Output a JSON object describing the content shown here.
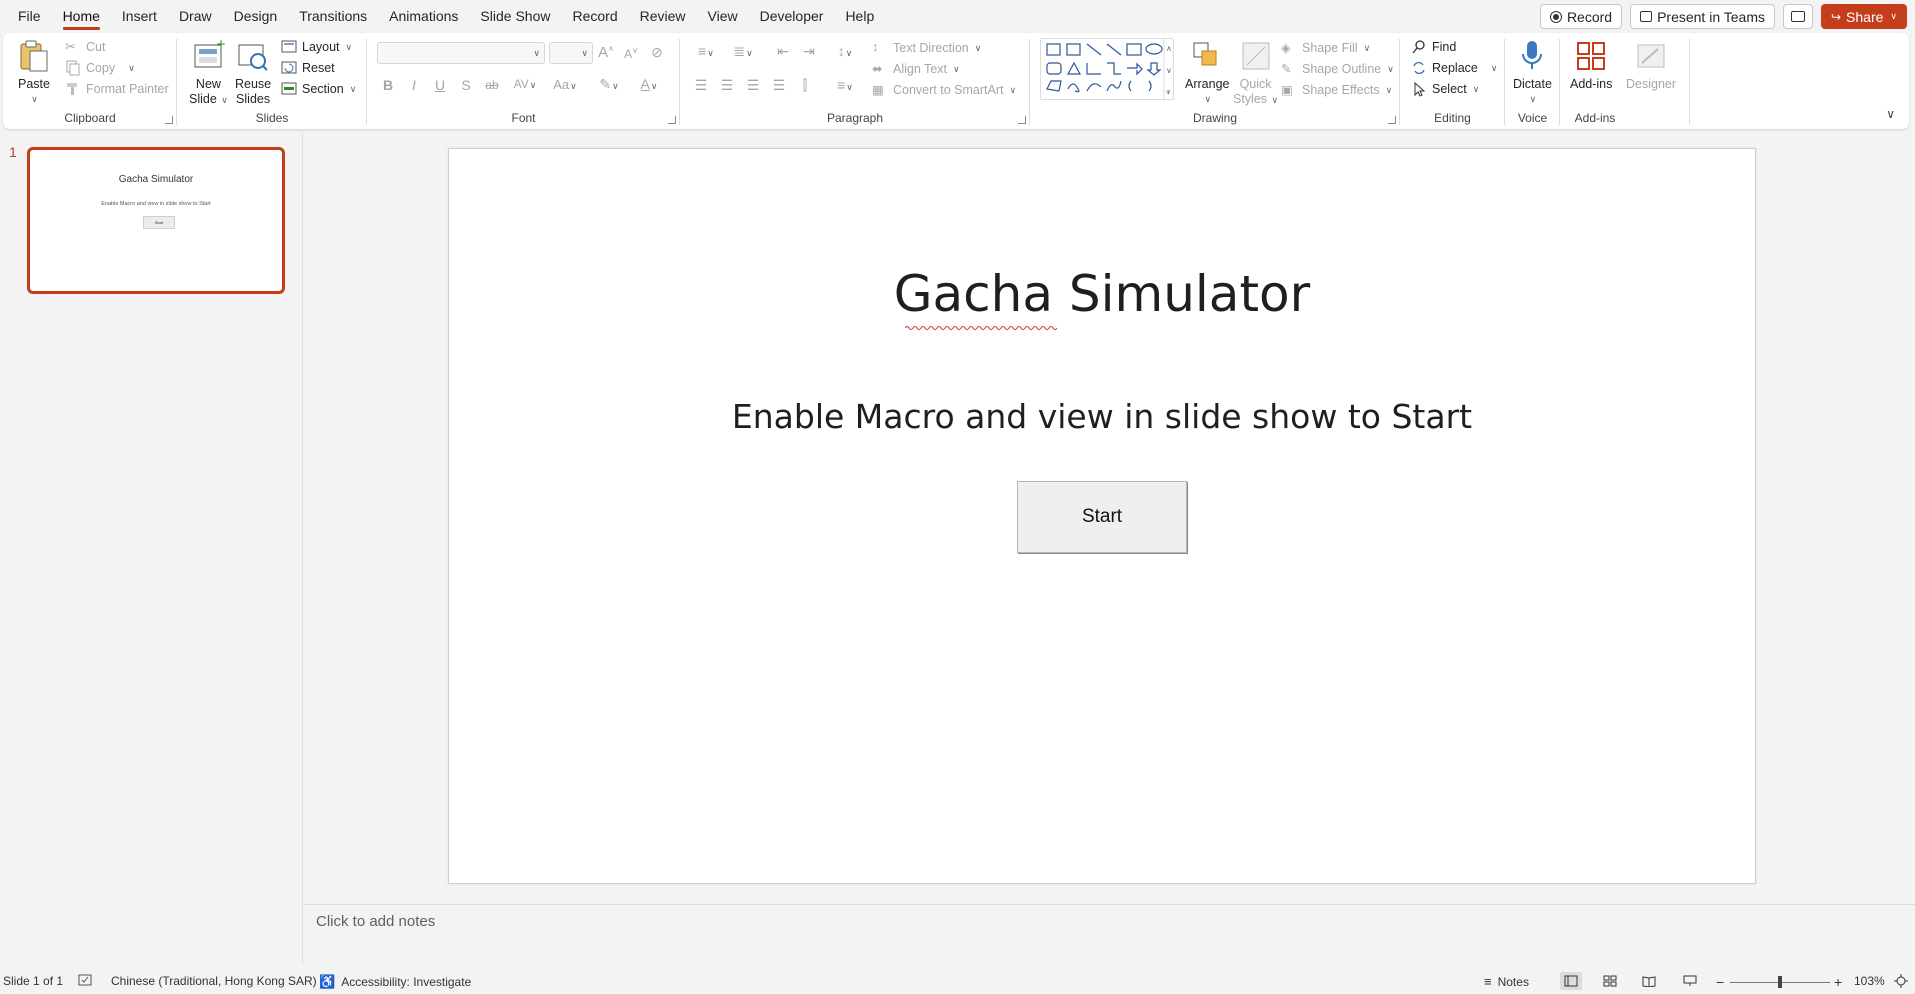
{
  "menu": {
    "tabs": [
      "File",
      "Home",
      "Insert",
      "Draw",
      "Design",
      "Transitions",
      "Animations",
      "Slide Show",
      "Record",
      "Review",
      "View",
      "Developer",
      "Help"
    ],
    "active_tab": "Home",
    "record_label": "Record",
    "present_label": "Present in Teams",
    "share_label": "Share"
  },
  "ribbon": {
    "clipboard": {
      "label": "Clipboard",
      "paste": "Paste",
      "cut": "Cut",
      "copy": "Copy",
      "format_painter": "Format Painter"
    },
    "slides": {
      "label": "Slides",
      "new_slide_1": "New",
      "new_slide_2": "Slide",
      "reuse_1": "Reuse",
      "reuse_2": "Slides",
      "layout": "Layout",
      "reset": "Reset",
      "section": "Section"
    },
    "font": {
      "label": "Font",
      "bold": "B",
      "italic": "I",
      "underline": "U",
      "shadow": "S",
      "strike": "ab",
      "spacing": "AV",
      "case": "Aa",
      "grow": "A",
      "shrink": "A"
    },
    "paragraph": {
      "label": "Paragraph",
      "text_direction": "Text Direction",
      "align_text": "Align Text",
      "convert_smartart": "Convert to SmartArt"
    },
    "drawing": {
      "label": "Drawing",
      "arrange": "Arrange",
      "quick_styles_1": "Quick",
      "quick_styles_2": "Styles",
      "shape_fill": "Shape Fill",
      "shape_outline": "Shape Outline",
      "shape_effects": "Shape Effects"
    },
    "editing": {
      "label": "Editing",
      "find": "Find",
      "replace": "Replace",
      "select": "Select"
    },
    "voice": {
      "label": "Voice",
      "dictate": "Dictate"
    },
    "addins": {
      "label": "Add-ins",
      "addins": "Add-ins",
      "designer": "Designer"
    }
  },
  "thumbnails": [
    {
      "number": "1",
      "title": "Gacha Simulator",
      "subtitle": "Enable Macro and view in slide show to Start",
      "button": "Start"
    }
  ],
  "slide": {
    "title": "Gacha Simulator",
    "subtitle": "Enable Macro and view in slide show to Start",
    "button_label": "Start"
  },
  "notes": {
    "placeholder": "Click to add notes"
  },
  "status": {
    "slide_info": "Slide 1 of 1",
    "language": "Chinese (Traditional, Hong Kong SAR)",
    "accessibility": "Accessibility: Investigate",
    "notes": "Notes",
    "zoom": "103%",
    "zoom_minus": "−",
    "zoom_plus": "+"
  },
  "colors": {
    "accent": "#c43e1c",
    "ribbon_bg": "#ffffff",
    "app_bg": "#f3f3f3"
  }
}
